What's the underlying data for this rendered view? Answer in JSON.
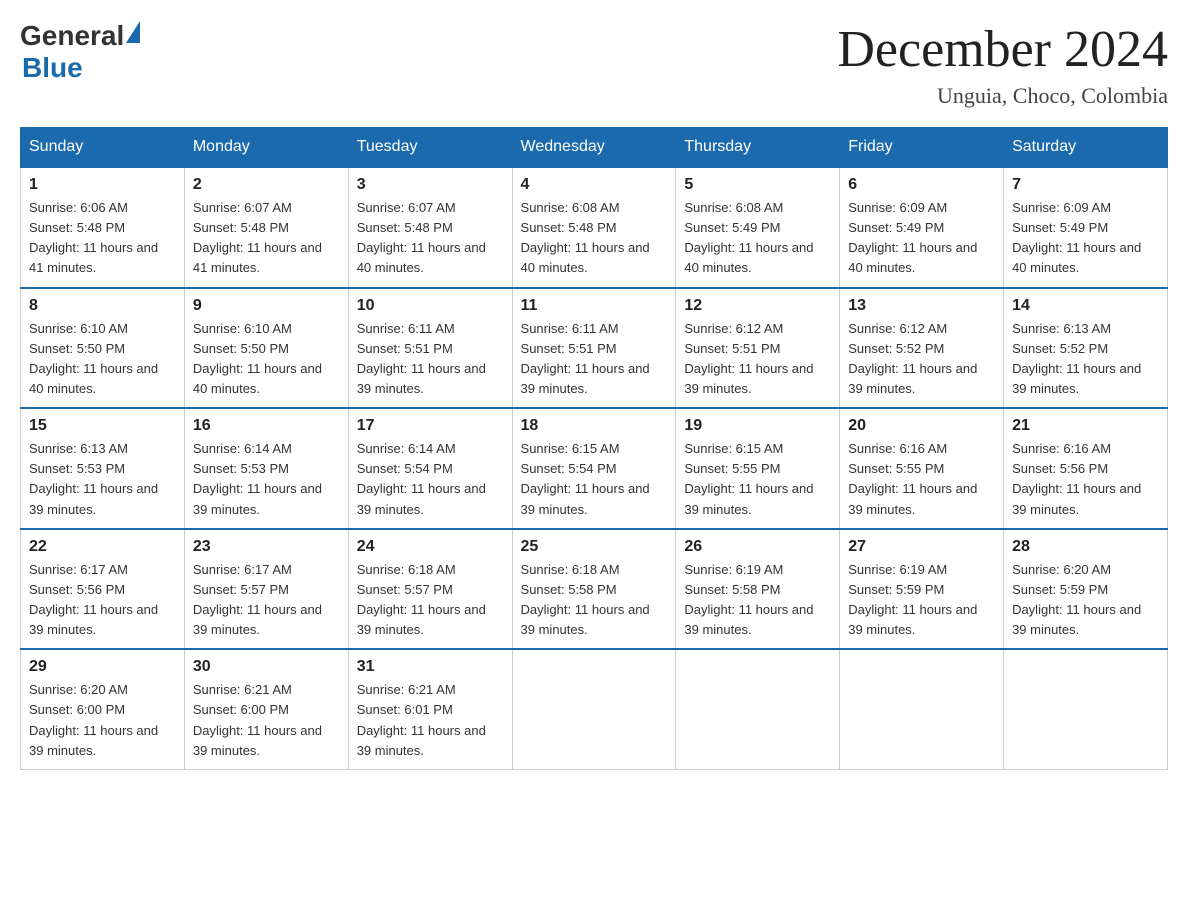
{
  "header": {
    "logo_general": "General",
    "logo_blue": "Blue",
    "title": "December 2024",
    "location": "Unguia, Choco, Colombia"
  },
  "weekdays": [
    "Sunday",
    "Monday",
    "Tuesday",
    "Wednesday",
    "Thursday",
    "Friday",
    "Saturday"
  ],
  "weeks": [
    [
      {
        "num": "1",
        "sunrise": "6:06 AM",
        "sunset": "5:48 PM",
        "daylight": "11 hours and 41 minutes."
      },
      {
        "num": "2",
        "sunrise": "6:07 AM",
        "sunset": "5:48 PM",
        "daylight": "11 hours and 41 minutes."
      },
      {
        "num": "3",
        "sunrise": "6:07 AM",
        "sunset": "5:48 PM",
        "daylight": "11 hours and 40 minutes."
      },
      {
        "num": "4",
        "sunrise": "6:08 AM",
        "sunset": "5:48 PM",
        "daylight": "11 hours and 40 minutes."
      },
      {
        "num": "5",
        "sunrise": "6:08 AM",
        "sunset": "5:49 PM",
        "daylight": "11 hours and 40 minutes."
      },
      {
        "num": "6",
        "sunrise": "6:09 AM",
        "sunset": "5:49 PM",
        "daylight": "11 hours and 40 minutes."
      },
      {
        "num": "7",
        "sunrise": "6:09 AM",
        "sunset": "5:49 PM",
        "daylight": "11 hours and 40 minutes."
      }
    ],
    [
      {
        "num": "8",
        "sunrise": "6:10 AM",
        "sunset": "5:50 PM",
        "daylight": "11 hours and 40 minutes."
      },
      {
        "num": "9",
        "sunrise": "6:10 AM",
        "sunset": "5:50 PM",
        "daylight": "11 hours and 40 minutes."
      },
      {
        "num": "10",
        "sunrise": "6:11 AM",
        "sunset": "5:51 PM",
        "daylight": "11 hours and 39 minutes."
      },
      {
        "num": "11",
        "sunrise": "6:11 AM",
        "sunset": "5:51 PM",
        "daylight": "11 hours and 39 minutes."
      },
      {
        "num": "12",
        "sunrise": "6:12 AM",
        "sunset": "5:51 PM",
        "daylight": "11 hours and 39 minutes."
      },
      {
        "num": "13",
        "sunrise": "6:12 AM",
        "sunset": "5:52 PM",
        "daylight": "11 hours and 39 minutes."
      },
      {
        "num": "14",
        "sunrise": "6:13 AM",
        "sunset": "5:52 PM",
        "daylight": "11 hours and 39 minutes."
      }
    ],
    [
      {
        "num": "15",
        "sunrise": "6:13 AM",
        "sunset": "5:53 PM",
        "daylight": "11 hours and 39 minutes."
      },
      {
        "num": "16",
        "sunrise": "6:14 AM",
        "sunset": "5:53 PM",
        "daylight": "11 hours and 39 minutes."
      },
      {
        "num": "17",
        "sunrise": "6:14 AM",
        "sunset": "5:54 PM",
        "daylight": "11 hours and 39 minutes."
      },
      {
        "num": "18",
        "sunrise": "6:15 AM",
        "sunset": "5:54 PM",
        "daylight": "11 hours and 39 minutes."
      },
      {
        "num": "19",
        "sunrise": "6:15 AM",
        "sunset": "5:55 PM",
        "daylight": "11 hours and 39 minutes."
      },
      {
        "num": "20",
        "sunrise": "6:16 AM",
        "sunset": "5:55 PM",
        "daylight": "11 hours and 39 minutes."
      },
      {
        "num": "21",
        "sunrise": "6:16 AM",
        "sunset": "5:56 PM",
        "daylight": "11 hours and 39 minutes."
      }
    ],
    [
      {
        "num": "22",
        "sunrise": "6:17 AM",
        "sunset": "5:56 PM",
        "daylight": "11 hours and 39 minutes."
      },
      {
        "num": "23",
        "sunrise": "6:17 AM",
        "sunset": "5:57 PM",
        "daylight": "11 hours and 39 minutes."
      },
      {
        "num": "24",
        "sunrise": "6:18 AM",
        "sunset": "5:57 PM",
        "daylight": "11 hours and 39 minutes."
      },
      {
        "num": "25",
        "sunrise": "6:18 AM",
        "sunset": "5:58 PM",
        "daylight": "11 hours and 39 minutes."
      },
      {
        "num": "26",
        "sunrise": "6:19 AM",
        "sunset": "5:58 PM",
        "daylight": "11 hours and 39 minutes."
      },
      {
        "num": "27",
        "sunrise": "6:19 AM",
        "sunset": "5:59 PM",
        "daylight": "11 hours and 39 minutes."
      },
      {
        "num": "28",
        "sunrise": "6:20 AM",
        "sunset": "5:59 PM",
        "daylight": "11 hours and 39 minutes."
      }
    ],
    [
      {
        "num": "29",
        "sunrise": "6:20 AM",
        "sunset": "6:00 PM",
        "daylight": "11 hours and 39 minutes."
      },
      {
        "num": "30",
        "sunrise": "6:21 AM",
        "sunset": "6:00 PM",
        "daylight": "11 hours and 39 minutes."
      },
      {
        "num": "31",
        "sunrise": "6:21 AM",
        "sunset": "6:01 PM",
        "daylight": "11 hours and 39 minutes."
      },
      null,
      null,
      null,
      null
    ]
  ]
}
